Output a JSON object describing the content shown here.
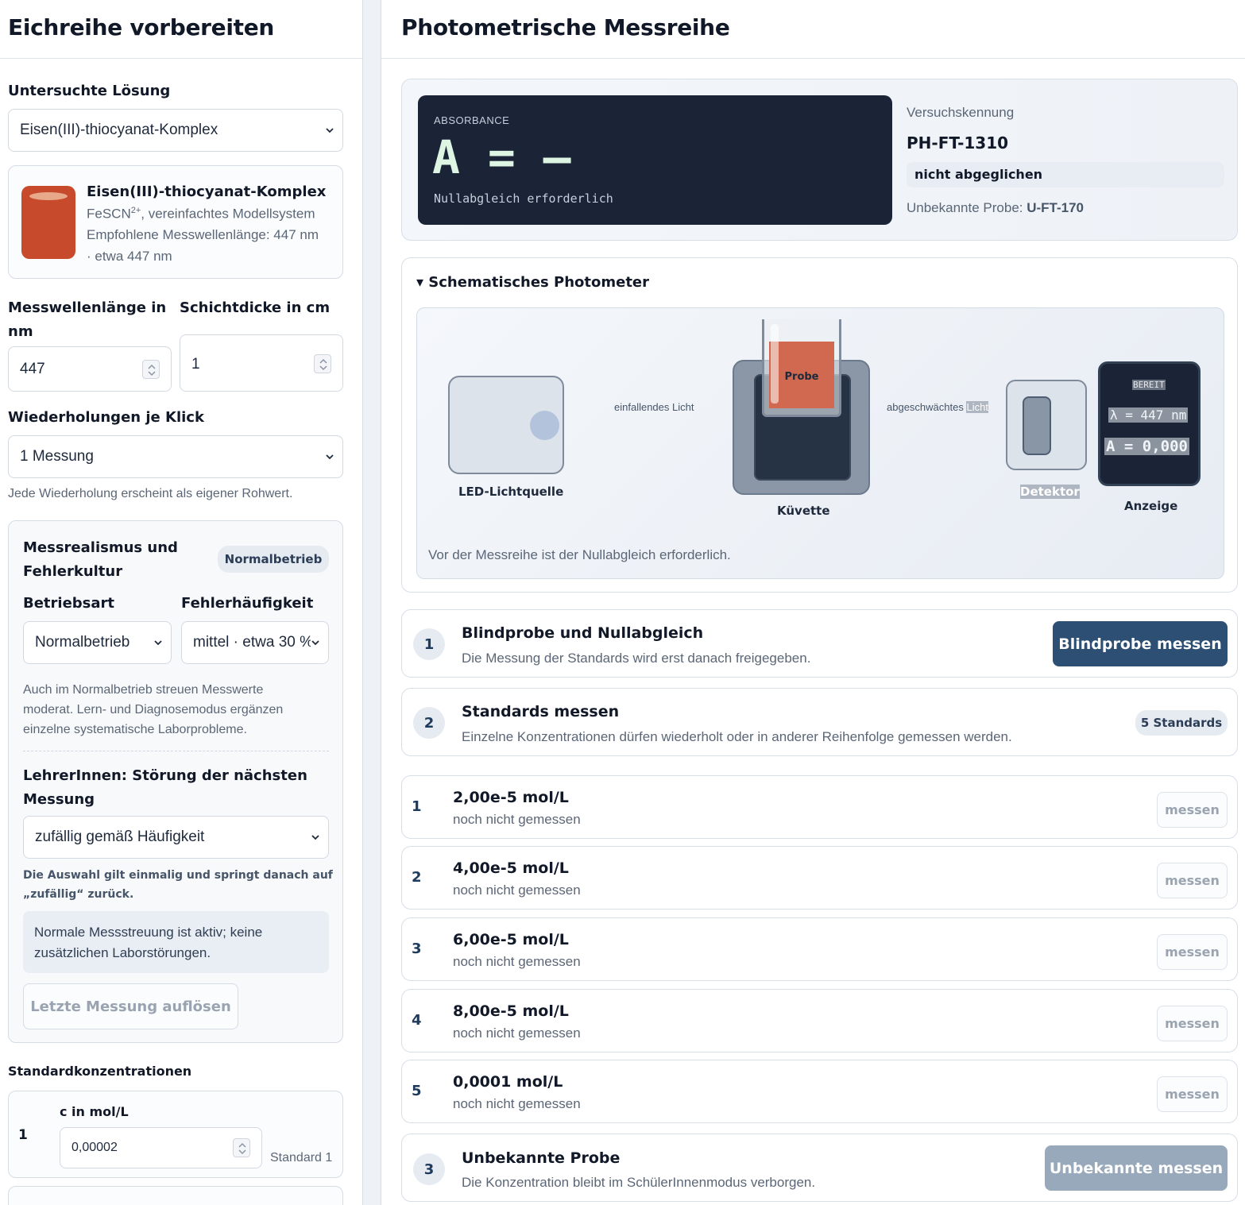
{
  "left": {
    "title": "Eichreihe vorbereiten",
    "solution_label": "Untersuchte Lösung",
    "solution_value": "Eisen(III)-thiocyanat-Komplex",
    "sample": {
      "name": "Eisen(III)-thiocyanat-Komplex",
      "formula": "FeSCN",
      "charge": "2+",
      "formula_suffix": ", vereinfachtes Modellsystem",
      "wavelength_line": "Empfohlene Messwellenlänge: 447 nm",
      "approx_line": "· etwa 447 nm",
      "color": "#c84a2c"
    },
    "wavelength_label_1": "Messwellenlänge in",
    "wavelength_label_2": "nm",
    "wavelength_value": "447",
    "thickness_label": "Schichtdicke in cm",
    "thickness_value": "1",
    "repeat_label": "Wiederholungen je Klick",
    "repeat_value": "1 Messung",
    "repeat_hint": "Jede Wiederholung erscheint als eigener Rohwert.",
    "realism": {
      "title_1": "Messrealismus und",
      "title_2": "Fehlerkultur",
      "badge": "Normalbetrieb",
      "mode_label": "Betriebsart",
      "mode_value": "Normalbetrieb",
      "freq_label": "Fehlerhäufigkeit",
      "freq_value": "mittel · etwa 30 %",
      "note_1": "Auch im Normalbetrieb streuen Messwerte",
      "note_2": "moderat. Lern- und Diagnosemodus ergänzen",
      "note_3": "einzelne systematische Laborprobleme.",
      "teacher_1": "LehrerInnen: Störung der nächsten",
      "teacher_2": "Messung",
      "teacher_value": "zufällig gemäß Häufigkeit",
      "teacher_hint_1": "Die Auswahl gilt einmalig und springt danach auf",
      "teacher_hint_2": "„zufällig“ zurück.",
      "info": "Normale Messstreuung ist aktiv; keine zusätzlichen Laborstörungen.",
      "resolve_button": "Letzte Messung auflösen"
    },
    "std_title": "Standardkonzentrationen",
    "std_rows": [
      {
        "idx": "1",
        "col_label": "c in mol/L",
        "value": "0,00002",
        "tag": "Standard 1"
      }
    ]
  },
  "right": {
    "title": "Photometrische Messreihe",
    "display": {
      "caption": "ABSORBANCE",
      "value": "A = –",
      "sub": "Nullabgleich erforderlich"
    },
    "meta": {
      "id_caption": "Versuchskennung",
      "id": "PH-FT-1310",
      "status": "nicht abgeglichen",
      "probe_prefix": "Unbekannte Probe: ",
      "probe_id": "U-FT-170"
    },
    "photometer": {
      "title": "▾ Schematisches Photometer",
      "led": "LED-Lichtquelle",
      "incident": "einfallendes Licht",
      "cuvette": "Küvette",
      "probe": "Probe",
      "attenuated": "abgeschwächtes",
      "light": "Licht",
      "detector": "Detektor",
      "display_label": "Anzeige",
      "screen_state": "BEREIT",
      "screen_lambda": "λ = 447 nm",
      "screen_abs": "A = 0,000",
      "note": "Vor der Messreihe ist der Nullabgleich erforderlich."
    },
    "steps": [
      {
        "num": "1",
        "title": "Blindprobe und Nullabgleich",
        "desc": "Die Messung der Standards wird erst danach freigegeben.",
        "button": "Blindprobe messen"
      },
      {
        "num": "2",
        "title": "Standards messen",
        "desc": "Einzelne Konzentrationen dürfen wiederholt oder in anderer Reihenfolge gemessen werden.",
        "badge": "5 Standards"
      },
      {
        "num": "3",
        "title": "Unbekannte Probe",
        "desc": "Die Konzentration bleibt im SchülerInnenmodus verborgen.",
        "button": "Unbekannte messen"
      }
    ],
    "standards": [
      {
        "idx": "1",
        "conc": "2,00e-5 mol/L",
        "state": "noch nicht gemessen",
        "button": "messen"
      },
      {
        "idx": "2",
        "conc": "4,00e-5 mol/L",
        "state": "noch nicht gemessen",
        "button": "messen"
      },
      {
        "idx": "3",
        "conc": "6,00e-5 mol/L",
        "state": "noch nicht gemessen",
        "button": "messen"
      },
      {
        "idx": "4",
        "conc": "8,00e-5 mol/L",
        "state": "noch nicht gemessen",
        "button": "messen"
      },
      {
        "idx": "5",
        "conc": "0,0001 mol/L",
        "state": "noch nicht gemessen",
        "button": "messen"
      }
    ]
  },
  "colors": {
    "primary": "#2c4f73",
    "disabled": "#98a9bb",
    "display_bg": "#1b2436"
  }
}
